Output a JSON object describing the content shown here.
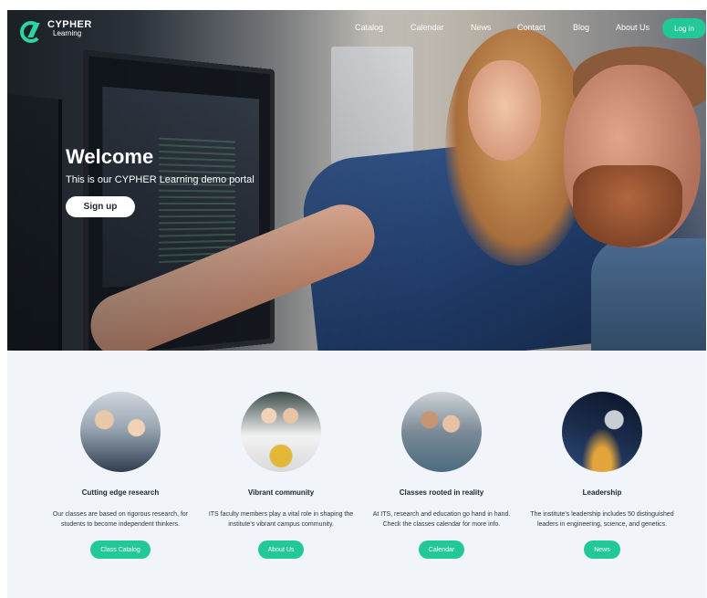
{
  "brand": {
    "name": "CYPHER",
    "sub": "Learning",
    "accent": "#22c997"
  },
  "nav": {
    "links": [
      "Catalog",
      "Calendar",
      "News",
      "Contact",
      "Blog",
      "About Us"
    ],
    "login_label": "Log in"
  },
  "hero": {
    "title": "Welcome",
    "subtitle": "This is our CYPHER Learning demo portal",
    "signup_label": "Sign up"
  },
  "features": [
    {
      "title": "Cutting edge research",
      "text": "Our classes are based on rigorous research, for students to become independent thinkers.",
      "button": "Class Catalog",
      "image": "research-photo"
    },
    {
      "title": "Vibrant community",
      "text": "ITS faculty members play a vital role in shaping the institute's vibrant campus community.",
      "button": "About Us",
      "image": "community-photo"
    },
    {
      "title": "Classes rooted in reality",
      "text": "At ITS, research and education go hand in hand. Check the classes calendar for more info.",
      "button": "Calendar",
      "image": "classes-photo"
    },
    {
      "title": "Leadership",
      "text": "The institute's leadership includes 50 distinguished leaders in engineering, science, and genetics.",
      "button": "News",
      "image": "satellite-photo"
    }
  ]
}
